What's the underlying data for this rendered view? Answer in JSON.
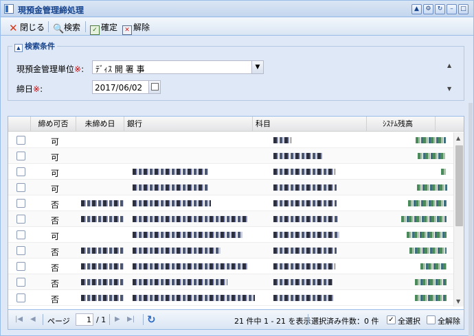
{
  "window": {
    "title": "現預金管理締処理"
  },
  "toolbar": {
    "close_label": "閉じる",
    "search_label": "検索",
    "confirm_label": "確定",
    "release_label": "解除"
  },
  "search": {
    "legend": "検索条件",
    "unit_label": "現預金管理単位",
    "unit_value": "ﾃﾞｨｽ 開 署 事",
    "date_label": "締日",
    "date_value": "2017/06/02",
    "required_mark": "※",
    "colon": ":"
  },
  "grid": {
    "columns": [
      "締め可否",
      "未締め日",
      "銀行",
      "科目",
      "ｼｽﾃﾑ残高"
    ],
    "rows": [
      {
        "status": "可"
      },
      {
        "status": "可"
      },
      {
        "status": "可"
      },
      {
        "status": "可"
      },
      {
        "status": "否"
      },
      {
        "status": "否"
      },
      {
        "status": "可"
      },
      {
        "status": "否"
      },
      {
        "status": "否"
      },
      {
        "status": "否"
      },
      {
        "status": "否"
      }
    ]
  },
  "pager": {
    "page_label": "ページ",
    "page_value": "1",
    "page_total": "/ 1",
    "display_info": "21 件中 1 - 21 を表示",
    "selected_info": "選択済み件数：0 件",
    "select_all_label": "全選択",
    "release_all_label": "全解除"
  },
  "colors": {
    "accent": "#15428b",
    "border": "#99bbe8",
    "panel": "#dfe8f6",
    "required": "#cc0000"
  }
}
